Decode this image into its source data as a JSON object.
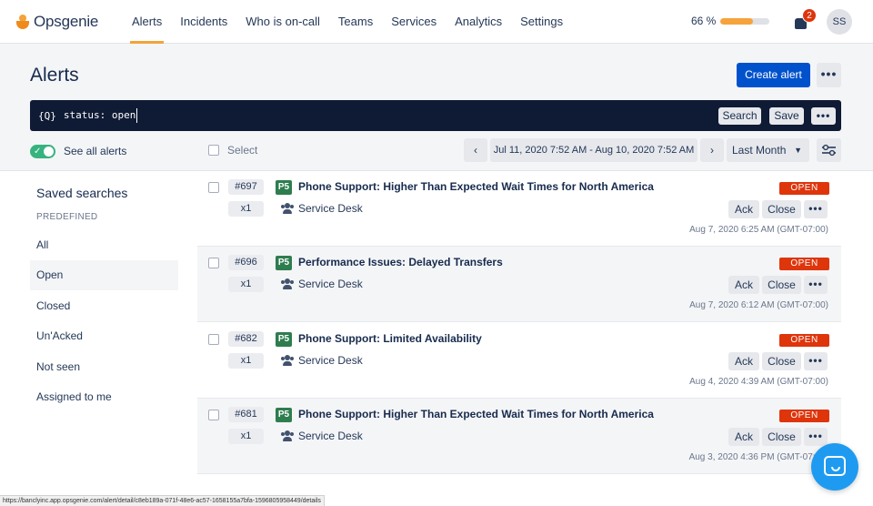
{
  "app": {
    "brand": "Opsgenie",
    "nav": [
      "Alerts",
      "Incidents",
      "Who is on-call",
      "Teams",
      "Services",
      "Analytics",
      "Settings"
    ],
    "active_nav": "Alerts",
    "progress_label": "66 %",
    "progress_value": 0.66,
    "notification_count": "2",
    "avatar_initials": "SS",
    "accent_color": "#f2a33a"
  },
  "header": {
    "title": "Alerts",
    "create_label": "Create alert",
    "more_label": "•••"
  },
  "search": {
    "icon_text": "{Q}",
    "query": "status: open",
    "help": "?",
    "search_label": "Search",
    "save_label": "Save",
    "more_label": "•••"
  },
  "filters": {
    "see_all_label": "See all alerts",
    "see_all_on": true,
    "select_label": "Select",
    "prev": "‹",
    "next": "›",
    "date_range": "Jul 11, 2020 7:52 AM - Aug 10, 2020 7:52 AM",
    "period": "Last Month",
    "period_chevron": "▼"
  },
  "sidebar": {
    "title": "Saved searches",
    "subtitle": "PREDEFINED",
    "items": [
      "All",
      "Open",
      "Closed",
      "Un'Acked",
      "Not seen",
      "Assigned to me"
    ],
    "selected": "Open"
  },
  "alerts": [
    {
      "number": "#697",
      "count": "x1",
      "priority": "P5",
      "title": "Phone Support: Higher Than Expected Wait Times for North America",
      "team": "Service Desk",
      "status": "OPEN",
      "ack": "Ack",
      "close": "Close",
      "more": "•••",
      "time": "Aug 7, 2020 6:25 AM (GMT-07:00)"
    },
    {
      "number": "#696",
      "count": "x1",
      "priority": "P5",
      "title": "Performance Issues: Delayed Transfers",
      "team": "Service Desk",
      "status": "OPEN",
      "ack": "Ack",
      "close": "Close",
      "more": "•••",
      "time": "Aug 7, 2020 6:12 AM (GMT-07:00)"
    },
    {
      "number": "#682",
      "count": "x1",
      "priority": "P5",
      "title": "Phone Support: Limited Availability",
      "team": "Service Desk",
      "status": "OPEN",
      "ack": "Ack",
      "close": "Close",
      "more": "•••",
      "time": "Aug 4, 2020 4:39 AM (GMT-07:00)"
    },
    {
      "number": "#681",
      "count": "x1",
      "priority": "P5",
      "title": "Phone Support: Higher Than Expected Wait Times for North America",
      "team": "Service Desk",
      "status": "OPEN",
      "ack": "Ack",
      "close": "Close",
      "more": "•••",
      "time": "Aug 3, 2020 4:36 PM (GMT-07:00)"
    }
  ],
  "status_bar_url": "https://banclyinc.app.opsgenie.com/alert/detail/c8eb189a-071f-48e6-ac57-1658155a7bfa-1596805958449/details",
  "colors": {
    "primary": "#0052cc",
    "search_bg": "#0f1a35",
    "open_badge": "#de350b",
    "priority_p5": "#2e7d4f",
    "toggle_on": "#36b37e",
    "chat": "#1e9bf0"
  }
}
